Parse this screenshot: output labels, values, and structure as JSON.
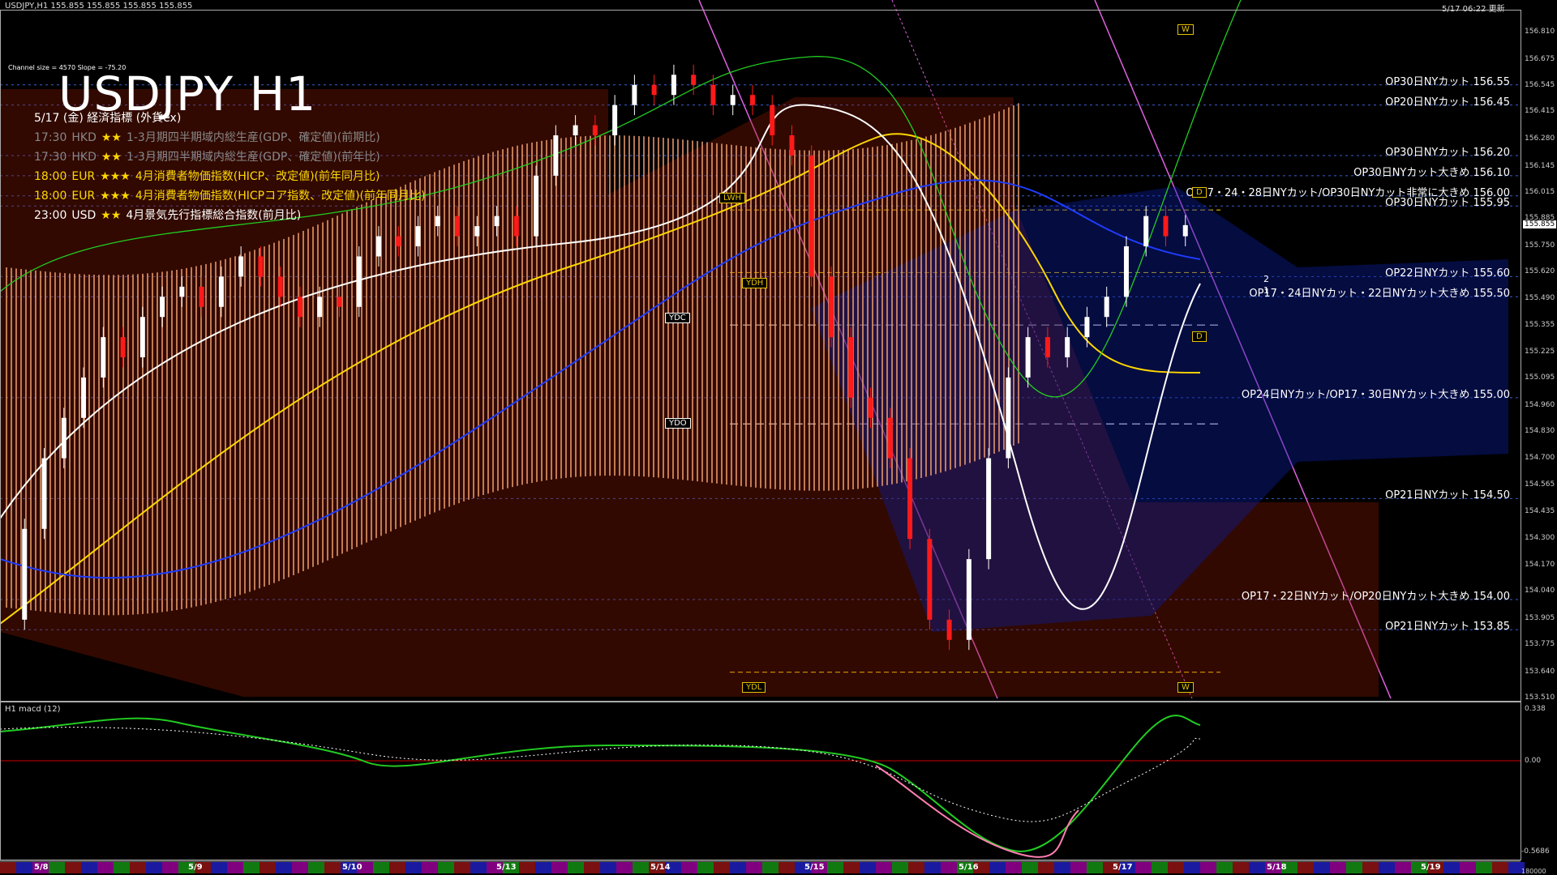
{
  "header": {
    "symbol_info": "USDJPY,H1  155.855 155.855 155.855 155.855",
    "update_time": "5/17 06:22 更新"
  },
  "title": "USDJPY H1",
  "channel_info": "Channel size = 4570 Slope = -75.20",
  "calendar": {
    "heading": "5/17 (金) 経済指標 (外貨ex)",
    "rows": [
      {
        "time": "17:30",
        "ccy": "HKD",
        "stars": "★★",
        "event": "1-3月期四半期域内総生産(GDP、確定値)(前期比)",
        "state": "past"
      },
      {
        "time": "17:30",
        "ccy": "HKD",
        "stars": "★★",
        "event": "1-3月期四半期域内総生産(GDP、確定値)(前年比)",
        "state": "past"
      },
      {
        "time": "18:00",
        "ccy": "EUR",
        "stars": "★★★",
        "event": "4月消費者物価指数(HICP、改定値)(前年同月比)",
        "state": "eur"
      },
      {
        "time": "18:00",
        "ccy": "EUR",
        "stars": "★★★",
        "event": "4月消費者物価指数(HICPコア指数、改定値)(前年同月比)",
        "state": "eur"
      },
      {
        "time": "23:00",
        "ccy": "USD",
        "stars": "★★",
        "event": "4月景気先行指標総合指数(前月比)",
        "state": "usd"
      }
    ]
  },
  "levels": [
    {
      "label": "OP30日NYカット 156.55",
      "price": 156.55
    },
    {
      "label": "OP20日NYカット 156.45",
      "price": 156.45
    },
    {
      "label": "OP30日NYカット 156.20",
      "price": 156.2
    },
    {
      "label": "OP30日NYカット大きめ 156.10",
      "price": 156.1
    },
    {
      "label": "OP17・24・28日NYカット/OP30日NYカット非常に大きめ 156.00",
      "price": 156.0
    },
    {
      "label": "OP30日NYカット 155.95",
      "price": 155.95
    },
    {
      "label": "OP22日NYカット 155.60",
      "price": 155.6
    },
    {
      "label": "OP17・24日NYカット・22日NYカット大きめ 155.50",
      "price": 155.5
    },
    {
      "label": "OP24日NYカット/OP17・30日NYカット大きめ 155.00",
      "price": 155.0
    },
    {
      "label": "OP21日NYカット 154.50",
      "price": 154.5
    },
    {
      "label": "OP17・22日NYカット/OP20日NYカット大きめ 154.00",
      "price": 154.0
    },
    {
      "label": "OP21日NYカット 153.85",
      "price": 153.85
    }
  ],
  "tags": {
    "lwh": "LWH",
    "ydh": "YDH",
    "ydc": "YDC",
    "ydo": "YDO",
    "ydl": "YDL",
    "w_top": "W",
    "w_bottom": "W",
    "d_top": "D",
    "d_mid": "D",
    "fib2": "2",
    "fib1": "1"
  },
  "macd": {
    "label": "H1 macd (12)",
    "max": "0.338",
    "zero": "0.00",
    "min": "-0.5686",
    "line_color": "#22cc22",
    "signal_color": "#ffffff",
    "negative_color": "#ff7fb0"
  },
  "chart_data": {
    "type": "candlestick",
    "title": "USDJPY H1",
    "ylim": [
      153.51,
      156.81
    ],
    "y_ticks": [
      "156.810",
      "156.675",
      "156.545",
      "156.415",
      "156.280",
      "156.145",
      "156.015",
      "155.885",
      "155.750",
      "155.620",
      "155.490",
      "155.355",
      "155.225",
      "155.095",
      "154.960",
      "154.830",
      "154.700",
      "154.565",
      "154.435",
      "154.300",
      "154.170",
      "154.040",
      "153.905",
      "153.775",
      "153.640",
      "153.510"
    ],
    "current_price": "155.855",
    "x_ticks": [
      "5/8",
      "5/9",
      "5/10",
      "5/13",
      "5/14",
      "5/15",
      "5/16",
      "5/17",
      "5/18",
      "5/19"
    ],
    "close_path": [
      153.9,
      154.35,
      154.7,
      154.9,
      155.1,
      155.3,
      155.2,
      155.4,
      155.5,
      155.55,
      155.45,
      155.6,
      155.7,
      155.6,
      155.5,
      155.4,
      155.5,
      155.45,
      155.7,
      155.8,
      155.75,
      155.85,
      155.9,
      155.8,
      155.85,
      155.9,
      155.8,
      156.1,
      156.3,
      156.35,
      156.3,
      156.45,
      156.55,
      156.5,
      156.6,
      156.55,
      156.45,
      156.5,
      156.45,
      156.3,
      156.2,
      155.6,
      155.3,
      155.0,
      154.9,
      154.7,
      154.3,
      153.9,
      153.8,
      154.2,
      154.7,
      155.1,
      155.3,
      155.2,
      155.3,
      155.4,
      155.5,
      155.75,
      155.9,
      155.8,
      155.855
    ],
    "key_levels": {
      "ydh": 155.62,
      "ydc": 155.36,
      "ydo": 154.87,
      "ydl": 153.64,
      "lwh": 155.93
    }
  }
}
